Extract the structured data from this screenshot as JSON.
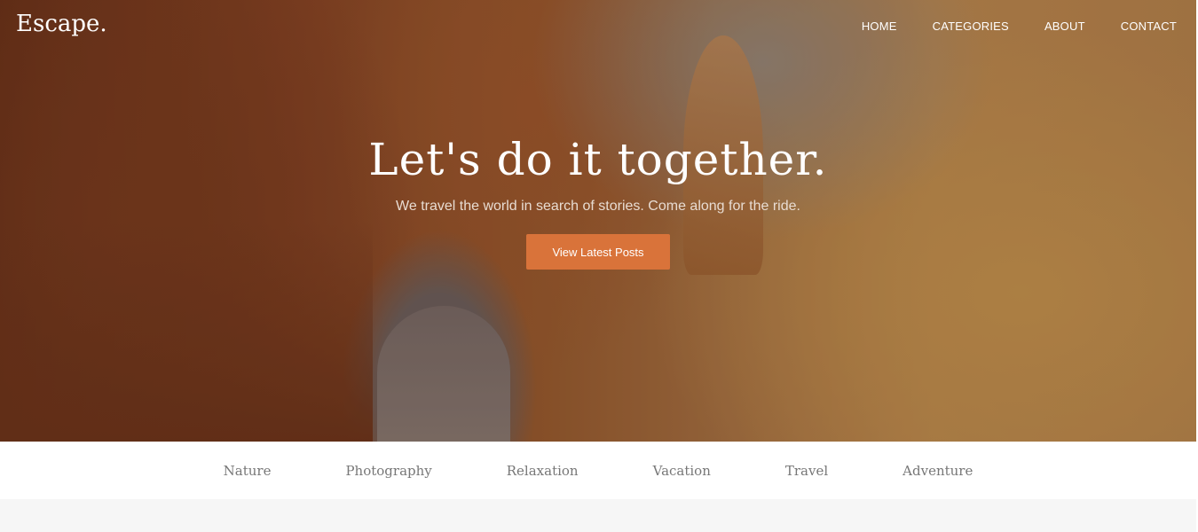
{
  "brand": {
    "name": "Escape."
  },
  "nav": {
    "items": [
      {
        "label": "HOME"
      },
      {
        "label": "CATEGORIES"
      },
      {
        "label": "ABOUT"
      },
      {
        "label": "CONTACT"
      }
    ]
  },
  "hero": {
    "title": "Let's do it together.",
    "subtitle": "We travel the world in search of stories. Come along for the ride.",
    "cta_label": "View Latest Posts"
  },
  "categories": [
    {
      "label": "Nature"
    },
    {
      "label": "Photography"
    },
    {
      "label": "Relaxation"
    },
    {
      "label": "Vacation"
    },
    {
      "label": "Travel"
    },
    {
      "label": "Adventure"
    }
  ],
  "colors": {
    "accent": "#d9733a",
    "category_text": "#777777"
  }
}
